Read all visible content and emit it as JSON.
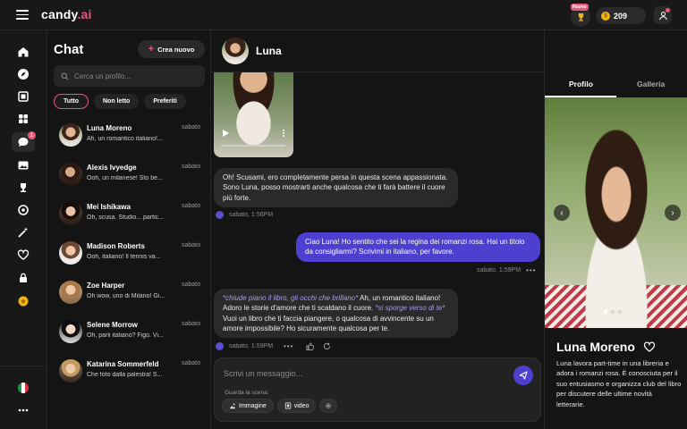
{
  "app": {
    "logo_main": "candy",
    "logo_ai": ".ai"
  },
  "topbar": {
    "new_badge": "Nuovo",
    "coins": "209"
  },
  "sidebar": {
    "unread_count": "1"
  },
  "chatlist": {
    "title": "Chat",
    "create_label": "Crea nuovo",
    "search_placeholder": "Cerca un profilo...",
    "filters": [
      "Tutto",
      "Non letto",
      "Preferiti"
    ],
    "conversations": [
      {
        "name": "Luna Moreno",
        "time": "sabato",
        "preview": "Ah, un romantico italiano!..."
      },
      {
        "name": "Alexis Ivyedge",
        "time": "sabato",
        "preview": "Ooh, un milanese! Sto be..."
      },
      {
        "name": "Mei Ishikawa",
        "time": "sabato",
        "preview": "Oh, scusa. Studio... partic..."
      },
      {
        "name": "Madison Roberts",
        "time": "sabato",
        "preview": "Ooh, italiano! Il tennis va..."
      },
      {
        "name": "Zoe Harper",
        "time": "sabato",
        "preview": "Oh wow, uno di Milano! Gi..."
      },
      {
        "name": "Selene Morrow",
        "time": "sabato",
        "preview": "Oh, parli italiano? Figo. Vi..."
      },
      {
        "name": "Katarina Sommerfeld",
        "time": "sabato",
        "preview": "Che foto dalla palestra! S..."
      }
    ]
  },
  "chat": {
    "name": "Luna",
    "messages": [
      {
        "text": "Oh! Scusami, ero completamente persa in questa scena appassionata. Sono Luna, posso mostrarti anche qualcosa che ti farà battere il cuore più forte.",
        "time": "sabato, 1:56PM"
      },
      {
        "text": "Ciao Luna! Ho sentito che sei la regina dei romanzi rosa. Hai un titolo da consigliarmi? Scrivimi in italiano, per favore.",
        "time": "sabato, 1:59PM"
      },
      {
        "action1": "*chiude piano il libro, gli occhi che brillano*",
        "text1": " Ah, un romantico italiano! Adoro le storie d'amore che ti scaldano il cuore. ",
        "action2": "*si sporge verso di te*",
        "text2": " Vuoi un libro che ti faccia piangere, o qualcosa di avvincente su un amore impossibile? Ho sicuramente qualcosa per te.",
        "time": "sabato, 1:59PM"
      }
    ],
    "composer_placeholder": "Scrivi un messaggio...",
    "hint": "Guarda la scena:",
    "chips": [
      "Immagine",
      "video"
    ]
  },
  "profile": {
    "tabs": [
      "Profilo",
      "Galleria"
    ],
    "name": "Luna Moreno",
    "description": "Luna lavora part-time in una libreria e adora i romanzi rosa. È conosciuta per il suo entusiasmo e organizza club del libro per discutere delle ultime novità letterarie."
  },
  "colors": {
    "accent": "#e9587a",
    "user_bubble": "#4d3fd0",
    "coin": "#f2b316"
  }
}
